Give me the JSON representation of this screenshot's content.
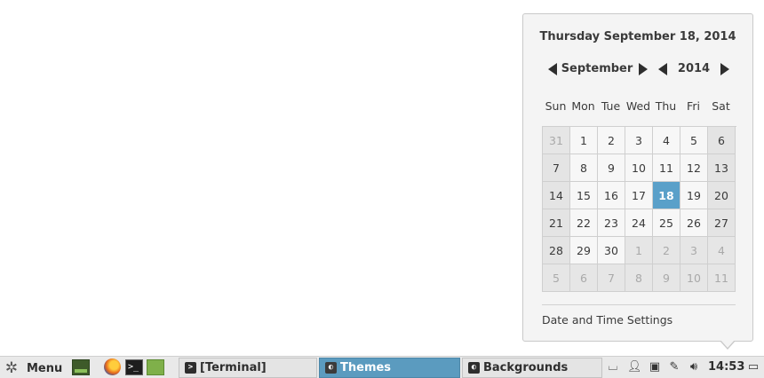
{
  "calendar": {
    "full_date": "Thursday September 18, 2014",
    "month": "September",
    "year": "2014",
    "weekdays": [
      "Sun",
      "Mon",
      "Tue",
      "Wed",
      "Thu",
      "Fri",
      "Sat"
    ],
    "weeks": [
      [
        {
          "d": "31",
          "other": true
        },
        {
          "d": "1"
        },
        {
          "d": "2"
        },
        {
          "d": "3"
        },
        {
          "d": "4"
        },
        {
          "d": "5"
        },
        {
          "d": "6"
        }
      ],
      [
        {
          "d": "7"
        },
        {
          "d": "8"
        },
        {
          "d": "9"
        },
        {
          "d": "10"
        },
        {
          "d": "11"
        },
        {
          "d": "12"
        },
        {
          "d": "13"
        }
      ],
      [
        {
          "d": "14"
        },
        {
          "d": "15"
        },
        {
          "d": "16"
        },
        {
          "d": "17"
        },
        {
          "d": "18",
          "today": true
        },
        {
          "d": "19"
        },
        {
          "d": "20"
        }
      ],
      [
        {
          "d": "21"
        },
        {
          "d": "22"
        },
        {
          "d": "23"
        },
        {
          "d": "24"
        },
        {
          "d": "25"
        },
        {
          "d": "26"
        },
        {
          "d": "27"
        }
      ],
      [
        {
          "d": "28"
        },
        {
          "d": "29"
        },
        {
          "d": "30"
        },
        {
          "d": "1",
          "other": true
        },
        {
          "d": "2",
          "other": true
        },
        {
          "d": "3",
          "other": true
        },
        {
          "d": "4",
          "other": true
        }
      ],
      [
        {
          "d": "5",
          "other": true
        },
        {
          "d": "6",
          "other": true
        },
        {
          "d": "7",
          "other": true
        },
        {
          "d": "8",
          "other": true
        },
        {
          "d": "9",
          "other": true
        },
        {
          "d": "10",
          "other": true
        },
        {
          "d": "11",
          "other": true
        }
      ]
    ],
    "settings_label": "Date and Time Settings"
  },
  "panel": {
    "menu_label": "Menu",
    "tasks": [
      {
        "label": "[Terminal]",
        "icon": "terminal-icon",
        "active": false
      },
      {
        "label": "Themes",
        "icon": "themes-icon",
        "active": true
      },
      {
        "label": "Backgrounds",
        "icon": "backgrounds-icon",
        "active": false
      }
    ],
    "clock": "14:53"
  },
  "colors": {
    "today_bg": "#5aa0c9",
    "active_task_bg": "#5b9bbf"
  }
}
